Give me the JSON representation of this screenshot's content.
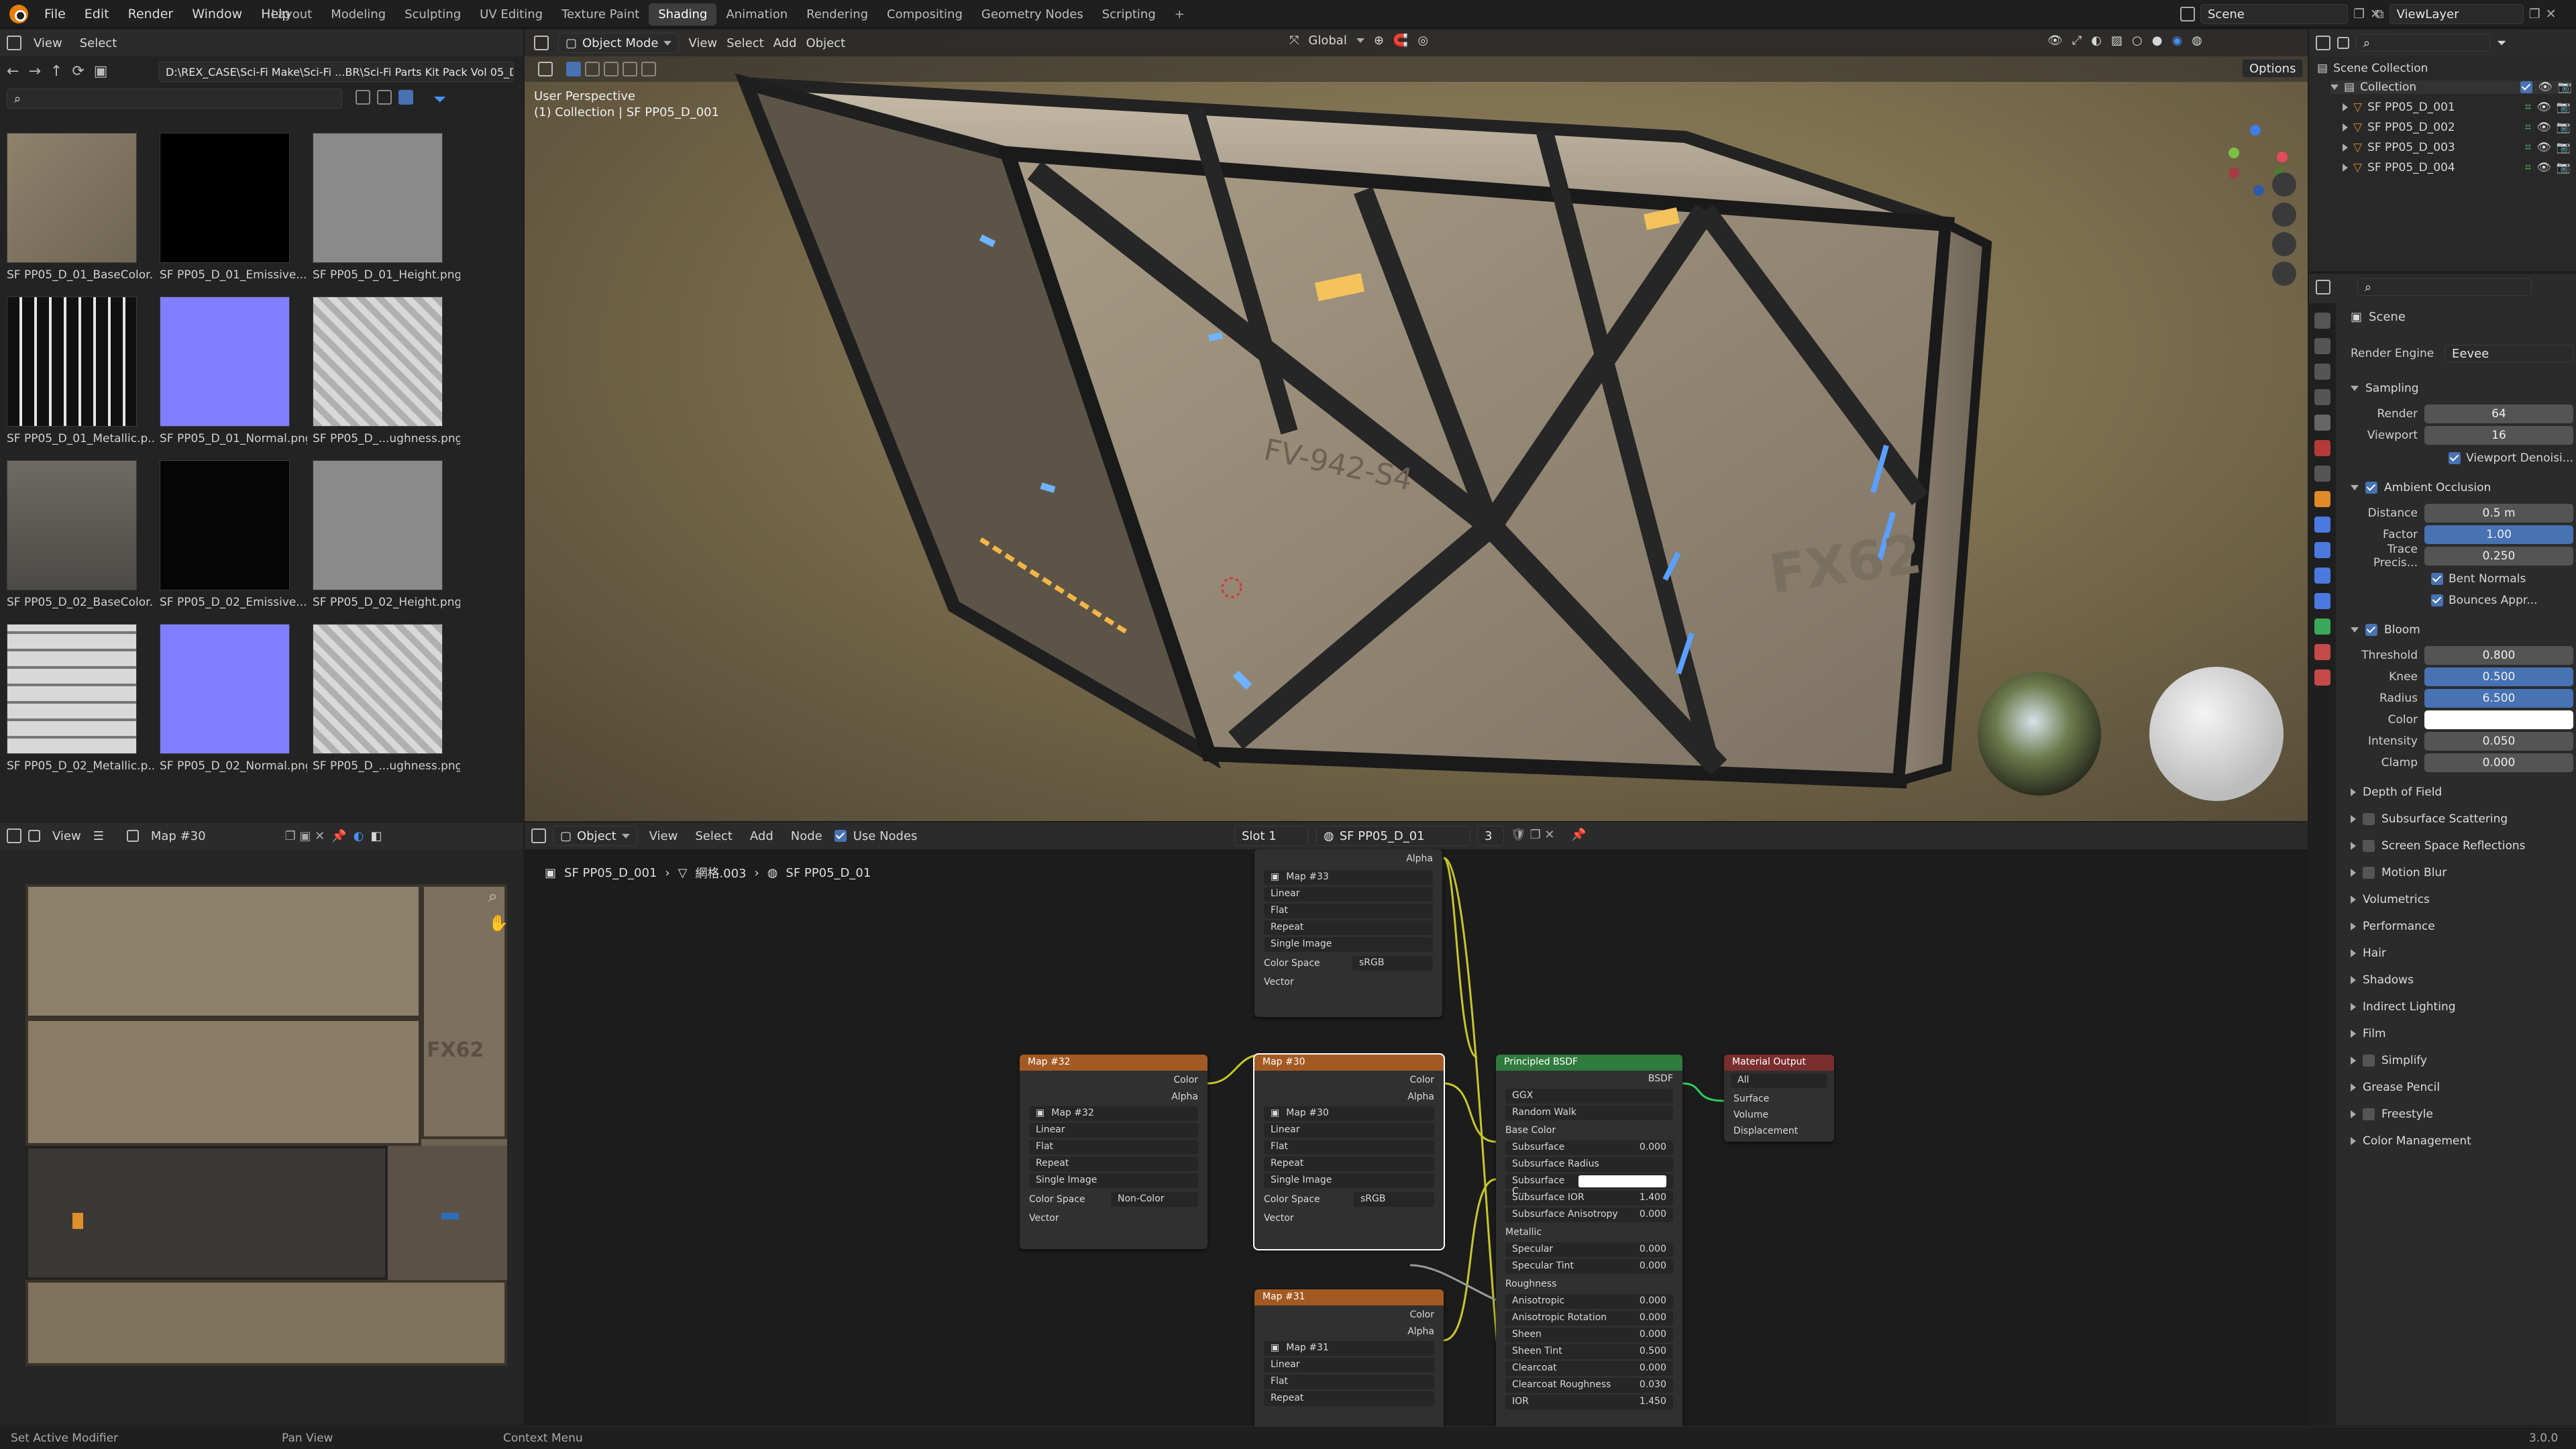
{
  "topbar": {
    "menus": [
      "File",
      "Edit",
      "Render",
      "Window",
      "Help"
    ],
    "workspaces": [
      "Layout",
      "Modeling",
      "Sculpting",
      "UV Editing",
      "Texture Paint",
      "Shading",
      "Animation",
      "Rendering",
      "Compositing",
      "Geometry Nodes",
      "Scripting"
    ],
    "active_workspace": "Shading",
    "scene": "Scene",
    "view_layer": "ViewLayer"
  },
  "file_browser": {
    "menus": [
      "View",
      "Select"
    ],
    "path": "D:\\REX_CASE\\Sci-Fi Make\\Sci-Fi ...BR\\Sci-Fi Parts Kit Pack Vol 05_D\\",
    "thumbnails": [
      {
        "label": "SF PP05_D_01_BaseColor...",
        "kind": "basecolor"
      },
      {
        "label": "SF PP05_D_01_Emissive...",
        "kind": "emissive"
      },
      {
        "label": "SF PP05_D_01_Height.png",
        "kind": "height"
      },
      {
        "label": "SF PP05_D_01_Metallic.p...",
        "kind": "metallic"
      },
      {
        "label": "SF PP05_D_01_Normal.png",
        "kind": "normal"
      },
      {
        "label": "SF PP05_D_...ughness.png",
        "kind": "rough"
      },
      {
        "label": "SF PP05_D_02_BaseColor...",
        "kind": "basecolor2"
      },
      {
        "label": "SF PP05_D_02_Emissive...",
        "kind": "emissive2"
      },
      {
        "label": "SF PP05_D_02_Height.png",
        "kind": "height"
      },
      {
        "label": "SF PP05_D_02_Metallic.p...",
        "kind": "metallic2"
      },
      {
        "label": "SF PP05_D_02_Normal.png",
        "kind": "normal"
      },
      {
        "label": "SF PP05_D_...ughness.png",
        "kind": "rough"
      }
    ]
  },
  "viewport": {
    "mode": "Object Mode",
    "menus": [
      "View",
      "Select",
      "Add",
      "Object"
    ],
    "transform": "Global",
    "options": "Options",
    "info_line1": "User Perspective",
    "info_line2": "(1) Collection | SF PP05_D_001",
    "decal1": "FV-942-S4",
    "decal2": "FX62"
  },
  "image_editor": {
    "view": "View",
    "image_name": "Map #30",
    "decal": "FX62"
  },
  "node_editor": {
    "object": "Object",
    "menus": [
      "View",
      "Select",
      "Add",
      "Node"
    ],
    "use_nodes": "Use Nodes",
    "slot": "Slot 1",
    "material": "SF PP05_D_01",
    "users": "3",
    "breadcrumb": [
      "SF PP05_D_001",
      "網格.003",
      "SF PP05_D_01"
    ],
    "nodes": {
      "map33": {
        "title": "Map #33",
        "img": "Map #33",
        "interp": "Linear",
        "proj": "Flat",
        "ext": "Repeat",
        "src": "Single Image",
        "cs_label": "Color Space",
        "cs": "sRGB",
        "vector": "Vector",
        "alpha": "Alpha"
      },
      "map32": {
        "title": "Map #32",
        "img": "Map #32",
        "interp": "Linear",
        "proj": "Flat",
        "ext": "Repeat",
        "src": "Single Image",
        "cs_label": "Color Space",
        "cs": "Non-Color",
        "vector": "Vector",
        "color": "Color",
        "alpha": "Alpha"
      },
      "map30": {
        "title": "Map #30",
        "img": "Map #30",
        "interp": "Linear",
        "proj": "Flat",
        "ext": "Repeat",
        "src": "Single Image",
        "cs_label": "Color Space",
        "cs": "sRGB",
        "vector": "Vector",
        "color": "Color",
        "alpha": "Alpha"
      },
      "map31": {
        "title": "Map #31",
        "img": "Map #31",
        "interp": "Linear",
        "proj": "Flat",
        "ext": "Repeat",
        "color": "Color",
        "alpha": "Alpha"
      },
      "bsdf": {
        "title": "Principled BSDF",
        "out": "BSDF",
        "dist": "GGX",
        "sss": "Random Walk",
        "rows": [
          {
            "k": "Base Color",
            "v": "",
            "type": "socket"
          },
          {
            "k": "Subsurface",
            "v": "0.000",
            "type": "field"
          },
          {
            "k": "Subsurface Radius",
            "v": "",
            "type": "dd"
          },
          {
            "k": "Subsurface C...",
            "v": "",
            "type": "color"
          },
          {
            "k": "Subsurface IOR",
            "v": "1.400",
            "type": "field"
          },
          {
            "k": "Subsurface Anisotropy",
            "v": "0.000",
            "type": "field"
          },
          {
            "k": "Metallic",
            "v": "",
            "type": "socket"
          },
          {
            "k": "Specular",
            "v": "0.000",
            "type": "field"
          },
          {
            "k": "Specular Tint",
            "v": "0.000",
            "type": "field"
          },
          {
            "k": "Roughness",
            "v": "",
            "type": "socket"
          },
          {
            "k": "Anisotropic",
            "v": "0.000",
            "type": "field"
          },
          {
            "k": "Anisotropic Rotation",
            "v": "0.000",
            "type": "field"
          },
          {
            "k": "Sheen",
            "v": "0.000",
            "type": "field"
          },
          {
            "k": "Sheen Tint",
            "v": "0.500",
            "type": "field"
          },
          {
            "k": "Clearcoat",
            "v": "0.000",
            "type": "field"
          },
          {
            "k": "Clearcoat Roughness",
            "v": "0.030",
            "type": "field"
          },
          {
            "k": "IOR",
            "v": "1.450",
            "type": "field"
          }
        ]
      },
      "output": {
        "title": "Material Output",
        "target": "All",
        "surface": "Surface",
        "volume": "Volume",
        "displacement": "Displacement"
      }
    }
  },
  "outliner": {
    "scene_collection": "Scene Collection",
    "collection": "Collection",
    "items": [
      "SF PP05_D_001",
      "SF PP05_D_002",
      "SF PP05_D_003",
      "SF PP05_D_004"
    ]
  },
  "properties": {
    "context": "Scene",
    "render_engine_label": "Render Engine",
    "render_engine": "Eevee",
    "sampling": {
      "title": "Sampling",
      "render_label": "Render",
      "render": "64",
      "viewport_label": "Viewport",
      "viewport": "16",
      "denoise": "Viewport Denoisi..."
    },
    "ao": {
      "title": "Ambient Occlusion",
      "distance_label": "Distance",
      "distance": "0.5 m",
      "factor_label": "Factor",
      "factor": "1.00",
      "trace_label": "Trace Precis...",
      "trace": "0.250",
      "bent": "Bent Normals",
      "bounces": "Bounces Appr..."
    },
    "bloom": {
      "title": "Bloom",
      "threshold_label": "Threshold",
      "threshold": "0.800",
      "knee_label": "Knee",
      "knee": "0.500",
      "radius_label": "Radius",
      "radius": "6.500",
      "color_label": "Color",
      "intensity_label": "Intensity",
      "intensity": "0.050",
      "clamp_label": "Clamp",
      "clamp": "0.000"
    },
    "panels": [
      "Depth of Field",
      "Subsurface Scattering",
      "Screen Space Reflections",
      "Motion Blur",
      "Volumetrics",
      "Performance",
      "Hair",
      "Shadows",
      "Indirect Lighting",
      "Film",
      "Simplify",
      "Grease Pencil",
      "Freestyle",
      "Color Management"
    ]
  },
  "statusbar": {
    "left": "Set Active Modifier",
    "mid": "Pan View",
    "right": "Context Menu",
    "version": "3.0.0"
  }
}
